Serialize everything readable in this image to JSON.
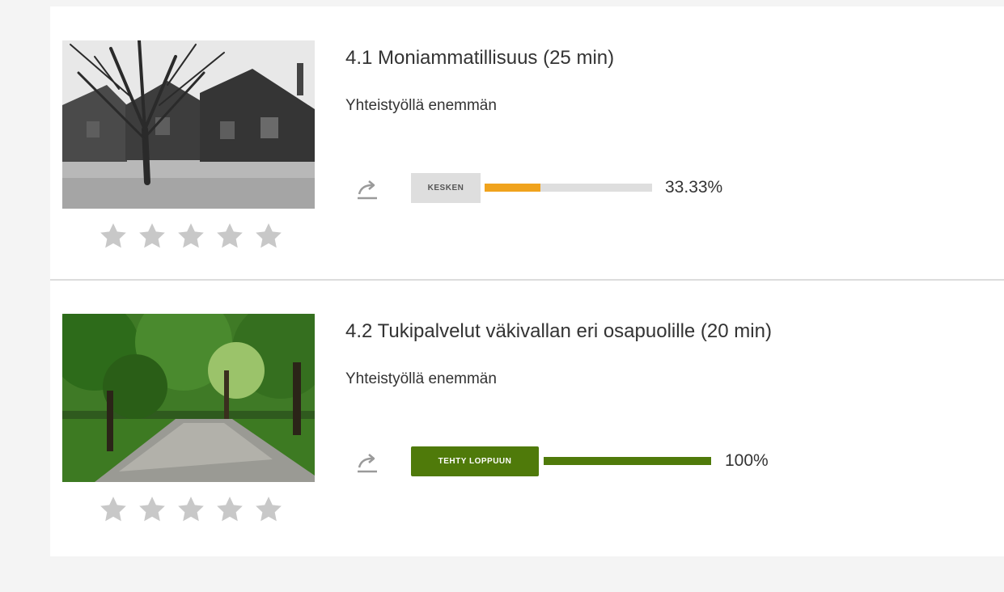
{
  "colors": {
    "progress_orange": "#f0a31d",
    "done_green": "#4f7a0a",
    "track_gray": "#dedede",
    "star_gray": "#c8c8c8"
  },
  "courses": [
    {
      "title": "4.1 Moniammatillisuus (25 min)",
      "subtitle": "Yhteistyöllä enemmän",
      "status_label": "KESKEN",
      "progress": 0.3333,
      "progress_text": "33.33%",
      "rating_stars_filled": 0,
      "rating_stars_total": 5,
      "thumbnail": "grayscale-stone-houses-bare-tree",
      "share_icon": "share-icon"
    },
    {
      "title": "4.2 Tukipalvelut väkivallan eri osapuolille (20 min)",
      "subtitle": "Yhteistyöllä enemmän",
      "status_label": "TEHTY LOPPUUN",
      "progress": 1.0,
      "progress_text": "100%",
      "rating_stars_filled": 0,
      "rating_stars_total": 5,
      "thumbnail": "green-tree-lined-gravel-road",
      "share_icon": "share-icon"
    }
  ]
}
